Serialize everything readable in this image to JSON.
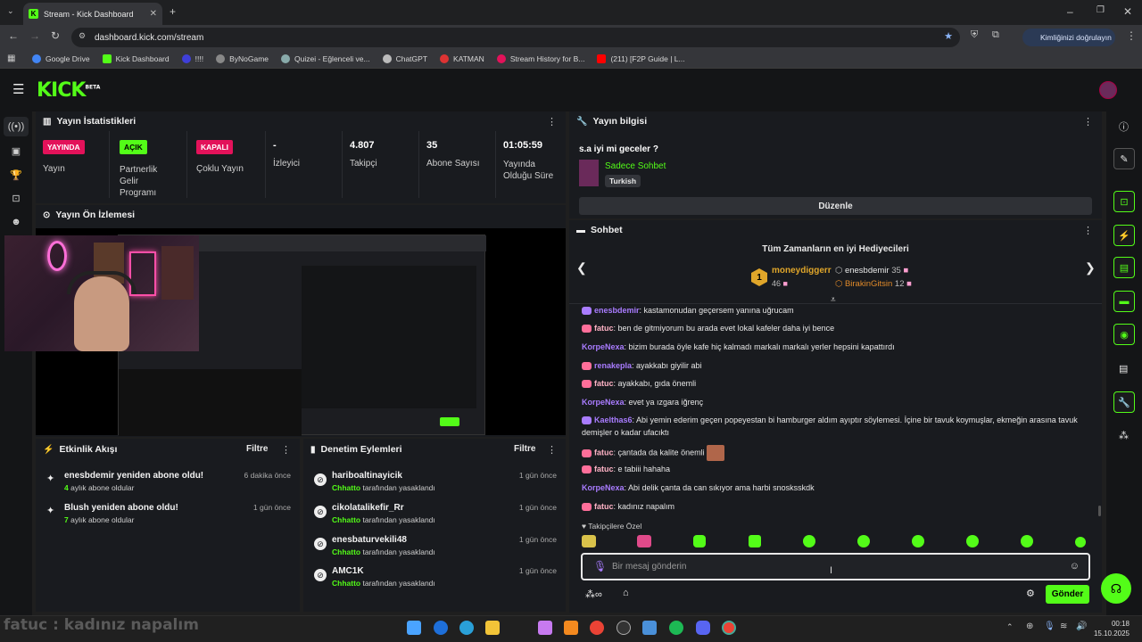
{
  "browser": {
    "tab_title": "Stream - Kick Dashboard",
    "url": "dashboard.kick.com/stream",
    "verify_label": "Kimliğinizi doğrulayın",
    "bookmarks": [
      "Google Drive",
      "Kick Dashboard",
      "!!!!",
      "ByNoGame",
      "Quizei - Eğlenceli ve...",
      "ChatGPT",
      "KATMAN",
      "Stream History for B...",
      "(211) [F2P Guide | L..."
    ]
  },
  "kick": {
    "logo": "KICK",
    "beta": "BETA"
  },
  "stats": {
    "title": "Yayın İstatistikleri",
    "live_badge": "YAYINDA",
    "live_label": "Yayın",
    "partner_badge": "AÇIK",
    "partner_label": "Partnerlik Gelir Programı",
    "multi_badge": "KAPALI",
    "multi_label": "Çoklu Yayın",
    "viewers_value": "-",
    "viewers_label": "İzleyici",
    "followers_value": "4.807",
    "followers_label": "Takipçi",
    "subs_value": "35",
    "subs_label": "Abone Sayısı",
    "uptime_value": "01:05:59",
    "uptime_label": "Yayında Olduğu Süre"
  },
  "preview": {
    "title": "Yayın Ön İzlemesi"
  },
  "events": {
    "title": "Etkinlik Akışı",
    "filter": "Filtre",
    "items": [
      {
        "title": "enesbdemir yeniden abone oldu!",
        "months": "4",
        "sub": "aylık abone oldular",
        "time": "6 dakika önce"
      },
      {
        "title": "Blush yeniden abone oldu!",
        "months": "7",
        "sub": "aylık abone oldular",
        "time": "1 gün önce"
      }
    ]
  },
  "moderation": {
    "title": "Denetim Eylemleri",
    "filter": "Filtre",
    "items": [
      {
        "user": "hariboaltinayicik",
        "mod": "Chhatto",
        "action": "tarafından yasaklandı",
        "time": "1 gün önce"
      },
      {
        "user": "cikolatalikefir_Rr",
        "mod": "Chhatto",
        "action": "tarafından yasaklandı",
        "time": "1 gün önce"
      },
      {
        "user": "enesbaturvekili48",
        "mod": "Chhatto",
        "action": "tarafından yasaklandı",
        "time": "1 gün önce"
      },
      {
        "user": "AMC1K",
        "mod": "Chhatto",
        "action": "tarafından yasaklandı",
        "time": "1 gün önce"
      }
    ]
  },
  "streaminfo": {
    "title": "Yayın bilgisi",
    "stream_title": "s.a iyi mi geceler ?",
    "category": "Sadece Sohbet",
    "tag": "Turkish",
    "edit_button": "Düzenle"
  },
  "chat": {
    "title": "Sohbet",
    "gifters_title": "Tüm Zamanların en iyi Hediyecileri",
    "top_gifter": {
      "rank": "1",
      "name": "moneydiggerr",
      "count": "46"
    },
    "gifter2": {
      "name": "enesbdemir",
      "count": "35"
    },
    "gifter3": {
      "name": "BirakinGitsin",
      "count": "12"
    },
    "messages": [
      {
        "user": "enesbdemir",
        "text": ": kastamonudan geçersem yanına uğrucam",
        "color": "#a97cff"
      },
      {
        "user": "fatuc",
        "text": ": ben de gitmiyorum bu arada evet lokal kafeler daha iyi bence",
        "color": "#ffb3c6"
      },
      {
        "user": "KorpeNexa",
        "text": ": bizim burada öyle kafe hiç kalmadı markalı markalı yerler hepsini kapattırdı",
        "color": "#a97cff"
      },
      {
        "user": "renakepla",
        "text": ": ayakkabı giyilir abi",
        "color": "#a97cff"
      },
      {
        "user": "fatuc",
        "text": ": ayakkabı, gıda önemli",
        "color": "#ffb3c6"
      },
      {
        "user": "KorpeNexa",
        "text": ": evet ya ızgara iğrenç",
        "color": "#a97cff"
      },
      {
        "user": "Kaelthas6",
        "text": ": Abi yemin ederim geçen popeyestan bi hamburger aldım ayıptır söylemesi. İçine bir tavuk koymuşlar, ekmeğin arasına tavuk demişler o kadar ufacıktı",
        "color": "#a97cff"
      },
      {
        "user": "fatuc",
        "text": ": çantada da kalite önemli",
        "color": "#ffb3c6"
      },
      {
        "user": "fatuc",
        "text": ": e tabiii hahaha",
        "color": "#ffb3c6"
      },
      {
        "user": "KorpeNexa",
        "text": ": Abi delik çanta da can sıkıyor ama harbi snosksskdk",
        "color": "#a97cff"
      },
      {
        "user": "fatuc",
        "text": ": kadınız napalım",
        "color": "#ffb3c6"
      }
    ],
    "followers_only": "Takipçilere Özel",
    "input_placeholder": "Bir mesaj gönderin",
    "send_button": "Gönder"
  },
  "overlay_text": "fatuc : kadınız napalım",
  "taskbar": {
    "time": "00:18",
    "date": "15.10.2025"
  },
  "colors": {
    "kick_green": "#53fc18",
    "live_red": "#e3125a",
    "panel_bg": "#191b1f"
  }
}
